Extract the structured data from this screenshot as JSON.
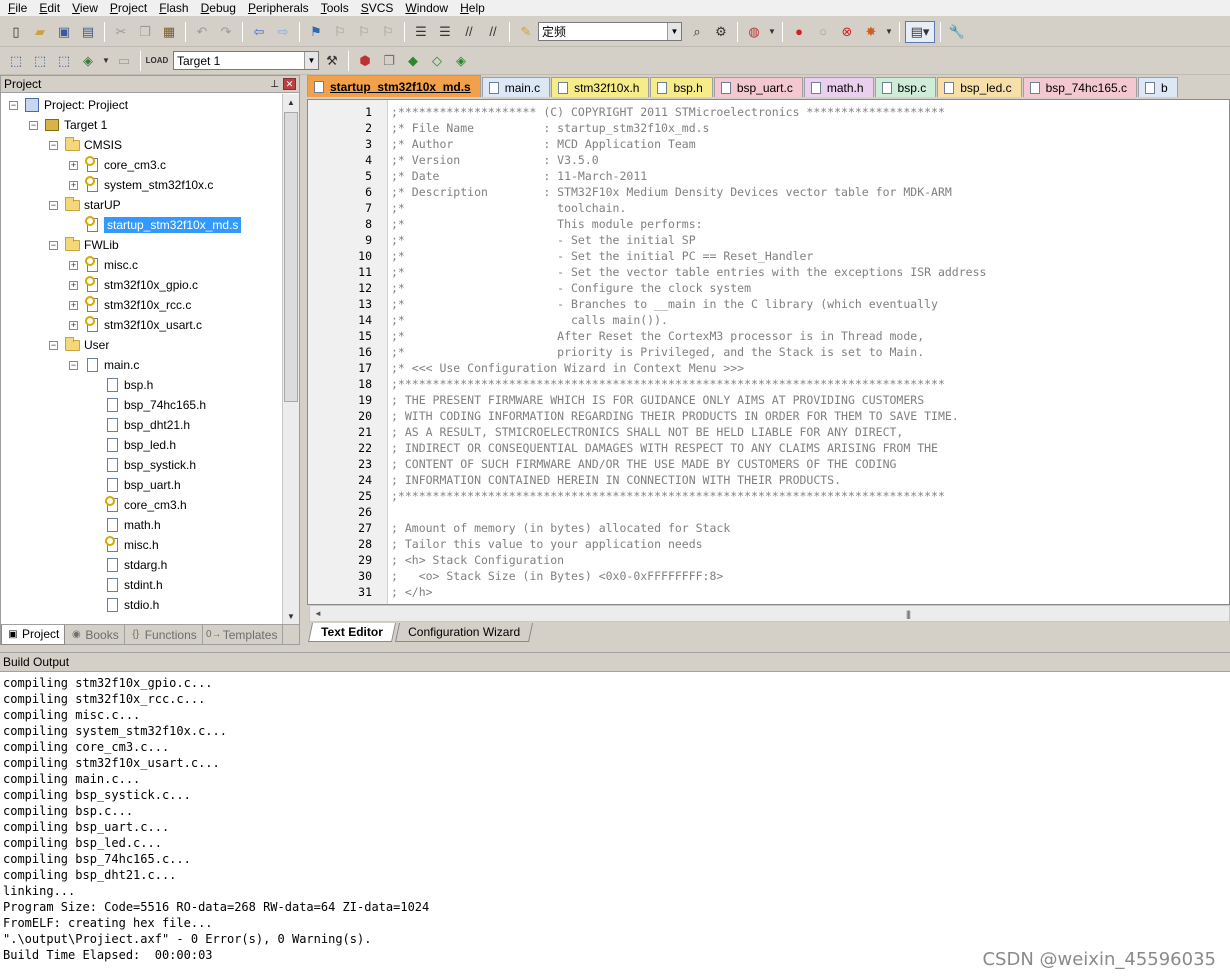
{
  "menu": [
    {
      "label": "File",
      "u": "F",
      "rest": "ile"
    },
    {
      "label": "Edit",
      "u": "E",
      "rest": "dit"
    },
    {
      "label": "View",
      "u": "V",
      "rest": "iew"
    },
    {
      "label": "Project",
      "u": "P",
      "rest": "roject"
    },
    {
      "label": "Flash",
      "u": "F",
      "rest": "lash"
    },
    {
      "label": "Debug",
      "u": "D",
      "rest": "ebug"
    },
    {
      "label": "Peripherals",
      "u": "P",
      "rest": "eripherals"
    },
    {
      "label": "Tools",
      "u": "T",
      "rest": "ools"
    },
    {
      "label": "SVCS",
      "u": "S",
      "rest": "VCS"
    },
    {
      "label": "Window",
      "u": "W",
      "rest": "indow"
    },
    {
      "label": "Help",
      "u": "H",
      "rest": "elp"
    }
  ],
  "toolbar": {
    "find_combo_value": "定频",
    "target_combo_value": "Target 1"
  },
  "project_panel": {
    "title": "Project",
    "pin": "ᵖ",
    "close": "✕",
    "tree": [
      {
        "label": "Project: Projiect",
        "level": 0,
        "icon": "project",
        "expander": "-"
      },
      {
        "label": "Target 1",
        "level": 1,
        "icon": "target",
        "expander": "-"
      },
      {
        "label": "CMSIS",
        "level": 2,
        "icon": "folder",
        "expander": "-"
      },
      {
        "label": "core_cm3.c",
        "level": 3,
        "icon": "filekey",
        "expander": "+"
      },
      {
        "label": "system_stm32f10x.c",
        "level": 3,
        "icon": "filekey",
        "expander": "+"
      },
      {
        "label": "starUP",
        "level": 2,
        "icon": "folder",
        "expander": "-"
      },
      {
        "label": "startup_stm32f10x_md.s",
        "level": 3,
        "icon": "filekey",
        "expander": "",
        "selected": true
      },
      {
        "label": "FWLib",
        "level": 2,
        "icon": "folder",
        "expander": "-"
      },
      {
        "label": "misc.c",
        "level": 3,
        "icon": "filekey",
        "expander": "+"
      },
      {
        "label": "stm32f10x_gpio.c",
        "level": 3,
        "icon": "filekey",
        "expander": "+"
      },
      {
        "label": "stm32f10x_rcc.c",
        "level": 3,
        "icon": "filekey",
        "expander": "+"
      },
      {
        "label": "stm32f10x_usart.c",
        "level": 3,
        "icon": "filekey",
        "expander": "+"
      },
      {
        "label": "User",
        "level": 2,
        "icon": "folder",
        "expander": "-"
      },
      {
        "label": "main.c",
        "level": 3,
        "icon": "file",
        "expander": "-"
      },
      {
        "label": "bsp.h",
        "level": 4,
        "icon": "file",
        "expander": ""
      },
      {
        "label": "bsp_74hc165.h",
        "level": 4,
        "icon": "file",
        "expander": ""
      },
      {
        "label": "bsp_dht21.h",
        "level": 4,
        "icon": "file",
        "expander": ""
      },
      {
        "label": "bsp_led.h",
        "level": 4,
        "icon": "file",
        "expander": ""
      },
      {
        "label": "bsp_systick.h",
        "level": 4,
        "icon": "file",
        "expander": ""
      },
      {
        "label": "bsp_uart.h",
        "level": 4,
        "icon": "file",
        "expander": ""
      },
      {
        "label": "core_cm3.h",
        "level": 4,
        "icon": "filekey",
        "expander": ""
      },
      {
        "label": "math.h",
        "level": 4,
        "icon": "file",
        "expander": ""
      },
      {
        "label": "misc.h",
        "level": 4,
        "icon": "filekey",
        "expander": ""
      },
      {
        "label": "stdarg.h",
        "level": 4,
        "icon": "file",
        "expander": ""
      },
      {
        "label": "stdint.h",
        "level": 4,
        "icon": "file",
        "expander": ""
      },
      {
        "label": "stdio.h",
        "level": 4,
        "icon": "file",
        "expander": ""
      }
    ],
    "tabs": [
      {
        "label": "Project",
        "icon": "▣",
        "active": true
      },
      {
        "label": "Books",
        "icon": "◉",
        "active": false
      },
      {
        "label": "Functions",
        "icon": "{}",
        "active": false
      },
      {
        "label": "Templates",
        "icon": "0→",
        "active": false
      }
    ]
  },
  "editor": {
    "tabs": [
      {
        "label": "startup_stm32f10x_md.s",
        "color": "#f2a04a",
        "active": true
      },
      {
        "label": "main.c",
        "color": "#dce8f6",
        "active": false
      },
      {
        "label": "stm32f10x.h",
        "color": "#f6ec8a",
        "active": false
      },
      {
        "label": "bsp.h",
        "color": "#f6ec8a",
        "active": false
      },
      {
        "label": "bsp_uart.c",
        "color": "#f4c8d0",
        "active": false
      },
      {
        "label": "math.h",
        "color": "#ead0ee",
        "active": false
      },
      {
        "label": "bsp.c",
        "color": "#cfecd8",
        "active": false
      },
      {
        "label": "bsp_led.c",
        "color": "#f6e0a8",
        "active": false
      },
      {
        "label": "bsp_74hc165.c",
        "color": "#f4c8d0",
        "active": false
      },
      {
        "label": "b",
        "color": "#dce8f6",
        "active": false
      }
    ],
    "lines": [
      {
        "n": "1",
        "t": ";******************** (C) COPYRIGHT 2011 STMicroelectronics ********************"
      },
      {
        "n": "2",
        "t": ";* File Name          : startup_stm32f10x_md.s"
      },
      {
        "n": "3",
        "t": ";* Author             : MCD Application Team"
      },
      {
        "n": "4",
        "t": ";* Version            : V3.5.0"
      },
      {
        "n": "5",
        "t": ";* Date               : 11-March-2011"
      },
      {
        "n": "6",
        "t": ";* Description        : STM32F10x Medium Density Devices vector table for MDK-ARM"
      },
      {
        "n": "7",
        "t": ";*                      toolchain."
      },
      {
        "n": "8",
        "t": ";*                      This module performs:"
      },
      {
        "n": "9",
        "t": ";*                      - Set the initial SP"
      },
      {
        "n": "10",
        "t": ";*                      - Set the initial PC == Reset_Handler"
      },
      {
        "n": "11",
        "t": ";*                      - Set the vector table entries with the exceptions ISR address"
      },
      {
        "n": "12",
        "t": ";*                      - Configure the clock system"
      },
      {
        "n": "13",
        "t": ";*                      - Branches to __main in the C library (which eventually"
      },
      {
        "n": "14",
        "t": ";*                        calls main())."
      },
      {
        "n": "15",
        "t": ";*                      After Reset the CortexM3 processor is in Thread mode,"
      },
      {
        "n": "16",
        "t": ";*                      priority is Privileged, and the Stack is set to Main."
      },
      {
        "n": "17",
        "t": ";* <<< Use Configuration Wizard in Context Menu >>>"
      },
      {
        "n": "18",
        "t": ";*******************************************************************************"
      },
      {
        "n": "19",
        "t": "; THE PRESENT FIRMWARE WHICH IS FOR GUIDANCE ONLY AIMS AT PROVIDING CUSTOMERS"
      },
      {
        "n": "20",
        "t": "; WITH CODING INFORMATION REGARDING THEIR PRODUCTS IN ORDER FOR THEM TO SAVE TIME."
      },
      {
        "n": "21",
        "t": "; AS A RESULT, STMICROELECTRONICS SHALL NOT BE HELD LIABLE FOR ANY DIRECT,"
      },
      {
        "n": "22",
        "t": "; INDIRECT OR CONSEQUENTIAL DAMAGES WITH RESPECT TO ANY CLAIMS ARISING FROM THE"
      },
      {
        "n": "23",
        "t": "; CONTENT OF SUCH FIRMWARE AND/OR THE USE MADE BY CUSTOMERS OF THE CODING"
      },
      {
        "n": "24",
        "t": "; INFORMATION CONTAINED HEREIN IN CONNECTION WITH THEIR PRODUCTS."
      },
      {
        "n": "25",
        "t": ";*******************************************************************************"
      },
      {
        "n": "26",
        "t": ""
      },
      {
        "n": "27",
        "t": "; Amount of memory (in bytes) allocated for Stack"
      },
      {
        "n": "28",
        "t": "; Tailor this value to your application needs"
      },
      {
        "n": "29",
        "t": "; <h> Stack Configuration"
      },
      {
        "n": "30",
        "t": ";   <o> Stack Size (in Bytes) <0x0-0xFFFFFFFF:8>"
      },
      {
        "n": "31",
        "t": "; </h>"
      }
    ],
    "bottom_tabs": [
      {
        "label": "Text Editor",
        "active": true
      },
      {
        "label": "Configuration Wizard",
        "active": false
      }
    ]
  },
  "build_output": {
    "title": "Build Output",
    "lines": [
      "compiling stm32f10x_gpio.c...",
      "compiling stm32f10x_rcc.c...",
      "compiling misc.c...",
      "compiling system_stm32f10x.c...",
      "compiling core_cm3.c...",
      "compiling stm32f10x_usart.c...",
      "compiling main.c...",
      "compiling bsp_systick.c...",
      "compiling bsp.c...",
      "compiling bsp_uart.c...",
      "compiling bsp_led.c...",
      "compiling bsp_74hc165.c...",
      "compiling bsp_dht21.c...",
      "linking...",
      "Program Size: Code=5516 RO-data=268 RW-data=64 ZI-data=1024",
      "FromELF: creating hex file...",
      "\".\\output\\Projiect.axf\" - 0 Error(s), 0 Warning(s).",
      "Build Time Elapsed:  00:00:03"
    ]
  },
  "watermark": "CSDN @weixin_45596035"
}
